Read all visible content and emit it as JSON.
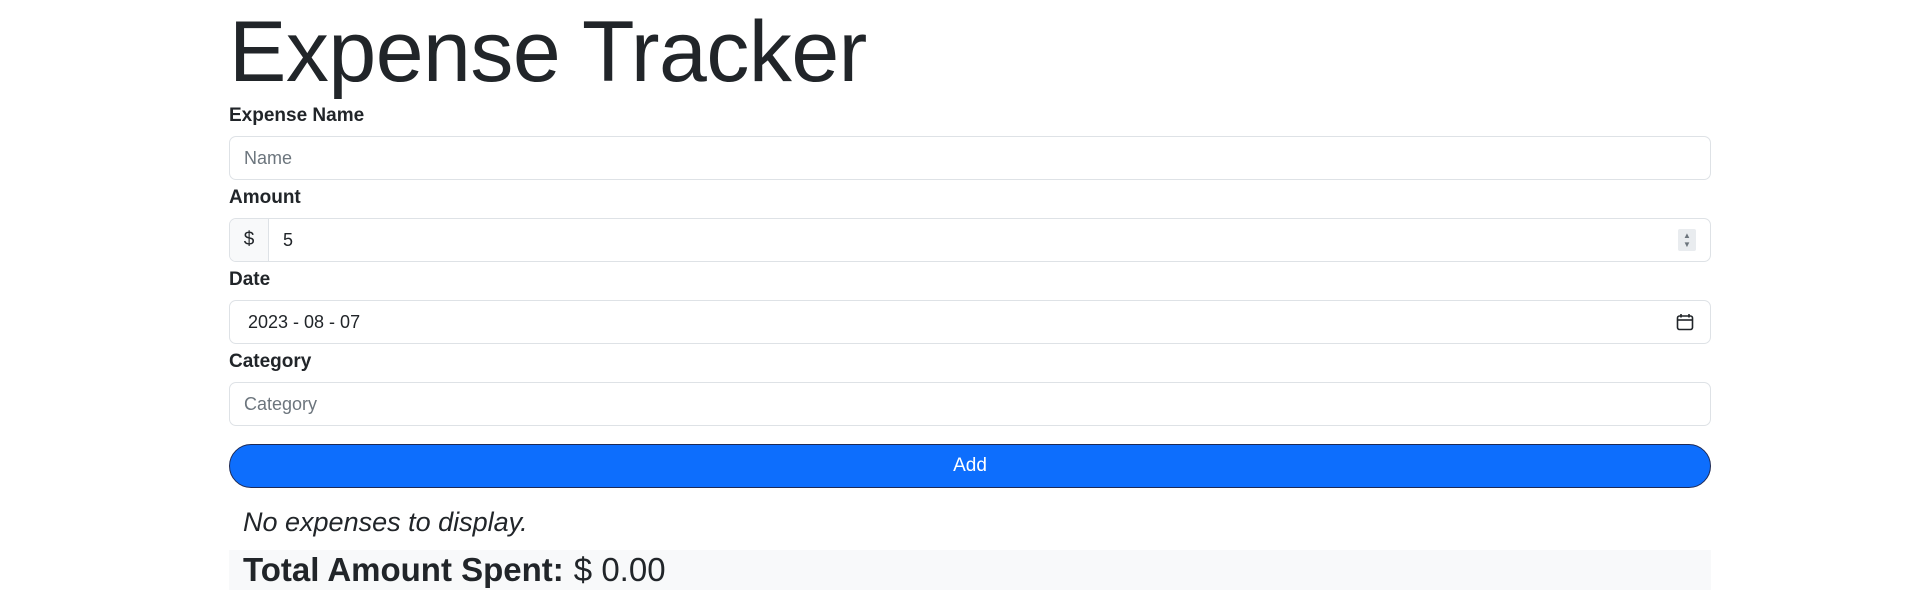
{
  "app": {
    "title": "Expense Tracker"
  },
  "form": {
    "name": {
      "label": "Expense Name",
      "placeholder": "Name",
      "value": ""
    },
    "amount": {
      "label": "Amount",
      "currency_symbol": "$",
      "value": "5"
    },
    "date": {
      "label": "Date",
      "value": "2023 - 08 - 07"
    },
    "category": {
      "label": "Category",
      "placeholder": "Category",
      "value": ""
    },
    "add_button_label": "Add"
  },
  "expenses": {
    "items": [],
    "empty_message": "No expenses to display."
  },
  "summary": {
    "total_label": "Total Amount Spent:",
    "total_value": "$ 0.00"
  },
  "icons": {
    "amount_spinner": "spin-button-icon",
    "date_picker": "calendar-icon"
  },
  "colors": {
    "primary": "#0d6efd",
    "text": "#212529",
    "border": "#dee2e6",
    "muted_bg": "#f8f9fa"
  }
}
